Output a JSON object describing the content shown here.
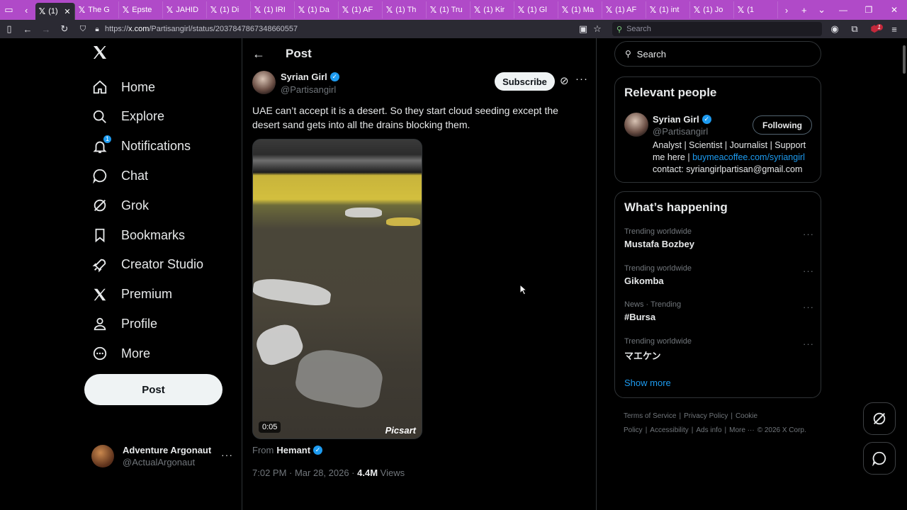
{
  "browser": {
    "tabs": [
      {
        "label": "(1)",
        "active": true
      },
      {
        "label": "The G"
      },
      {
        "label": "Epste"
      },
      {
        "label": "JAHID"
      },
      {
        "label": "(1) Di"
      },
      {
        "label": "(1) IRI"
      },
      {
        "label": "(1) Da"
      },
      {
        "label": "(1) AF"
      },
      {
        "label": "(1) Th"
      },
      {
        "label": "(1) Tru"
      },
      {
        "label": "(1) Kir"
      },
      {
        "label": "(1) Gl"
      },
      {
        "label": "(1) Ma"
      },
      {
        "label": "(1) AF"
      },
      {
        "label": "(1) int"
      },
      {
        "label": "(1) Jo"
      },
      {
        "label": "(1"
      }
    ],
    "url_prefix": "https://",
    "url_domain": "x.com",
    "url_path": "/Partisangirl/status/2037847867348660557",
    "search_placeholder": "Search",
    "ext_badge": "1"
  },
  "nav": {
    "items": [
      {
        "label": "Home",
        "icon": "home-icon"
      },
      {
        "label": "Explore",
        "icon": "search-icon"
      },
      {
        "label": "Notifications",
        "icon": "bell-icon",
        "badge": "1"
      },
      {
        "label": "Chat",
        "icon": "chat-icon"
      },
      {
        "label": "Grok",
        "icon": "grok-icon"
      },
      {
        "label": "Bookmarks",
        "icon": "bookmark-icon"
      },
      {
        "label": "Creator Studio",
        "icon": "rocket-icon"
      },
      {
        "label": "Premium",
        "icon": "x-logo-icon"
      },
      {
        "label": "Profile",
        "icon": "person-icon"
      },
      {
        "label": "More",
        "icon": "more-circle-icon"
      }
    ],
    "post_label": "Post",
    "account": {
      "name": "Adventure Argonaut",
      "handle": "@ActualArgonaut"
    }
  },
  "post": {
    "header_title": "Post",
    "author_name": "Syrian Girl",
    "author_handle": "@Partisangirl",
    "subscribe_label": "Subscribe",
    "text": "UAE can’t accept it is a desert. So they start cloud seeding except the desert sand gets into all the drains blocking them.",
    "video_time": "0:05",
    "watermark": "Picsart",
    "from_label": "From",
    "from_name": "Hemant",
    "timestamp": "7:02 PM · Mar 28, 2026 ·",
    "views_count": "4.4M",
    "views_label": "Views"
  },
  "right": {
    "search_placeholder": "Search",
    "relevant_title": "Relevant people",
    "person": {
      "name": "Syrian Girl",
      "handle": "@Partisangirl",
      "follow_label": "Following",
      "bio_start": "Analyst | Scientist | Journalist | Support me here | ",
      "bio_link": "buymeacoffee.com/syriangirl",
      "bio_contact": "contact: syriangirlpartisan@gmail.com"
    },
    "happening_title": "What’s happening",
    "trends": [
      {
        "context": "Trending worldwide",
        "title": "Mustafa Bozbey"
      },
      {
        "context": "Trending worldwide",
        "title": "Gikomba"
      },
      {
        "context": "News · Trending",
        "title": "#Bursa"
      },
      {
        "context": "Trending worldwide",
        "title": "マエケン"
      }
    ],
    "show_more": "Show more",
    "footer": [
      "Terms of Service",
      "|",
      "Privacy Policy",
      "|",
      "Cookie Policy",
      "|",
      "Accessibility",
      "|",
      "Ads info",
      "|",
      "More ···",
      "© 2026 X Corp."
    ]
  },
  "colors": {
    "accent": "#1d9bf0",
    "tabbar": "#b04ac8",
    "background": "#000000"
  }
}
